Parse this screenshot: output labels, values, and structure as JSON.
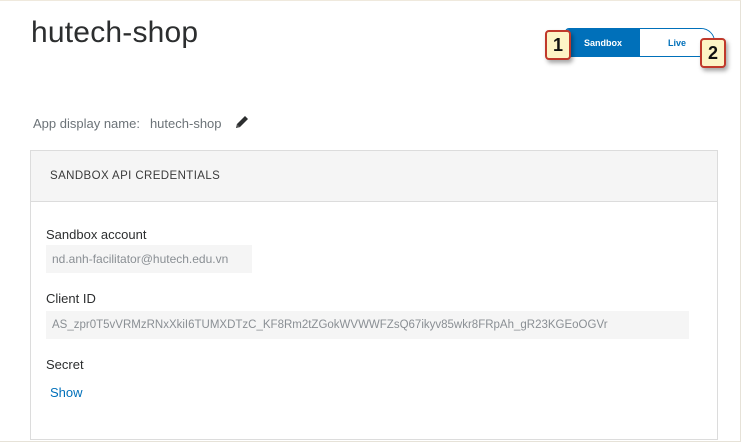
{
  "app": {
    "title": "hutech-shop"
  },
  "environment_toggle": {
    "sandbox_label": "Sandbox",
    "live_label": "Live",
    "selected": "Sandbox"
  },
  "callouts": {
    "one": "1",
    "two": "2"
  },
  "display_name": {
    "label": "App display name:",
    "value": "hutech-shop"
  },
  "credentials": {
    "header": "SANDBOX API CREDENTIALS",
    "sandbox_account_label": "Sandbox account",
    "sandbox_account_value": "nd.anh-facilitator@hutech.edu.vn",
    "client_id_label": "Client ID",
    "client_id_value": "AS_zpr0T5vVRMzRNxXkiI6TUMXDTzC_KF8Rm2tZGokWVWWFZsQ67ikyv85wkr8FRpAh_gR23KGEoOGVr",
    "secret_label": "Secret",
    "show_link": "Show"
  },
  "colors": {
    "accent": "#0070ba",
    "callout_fill": "#fdf4c6",
    "callout_border": "#c0392b"
  }
}
